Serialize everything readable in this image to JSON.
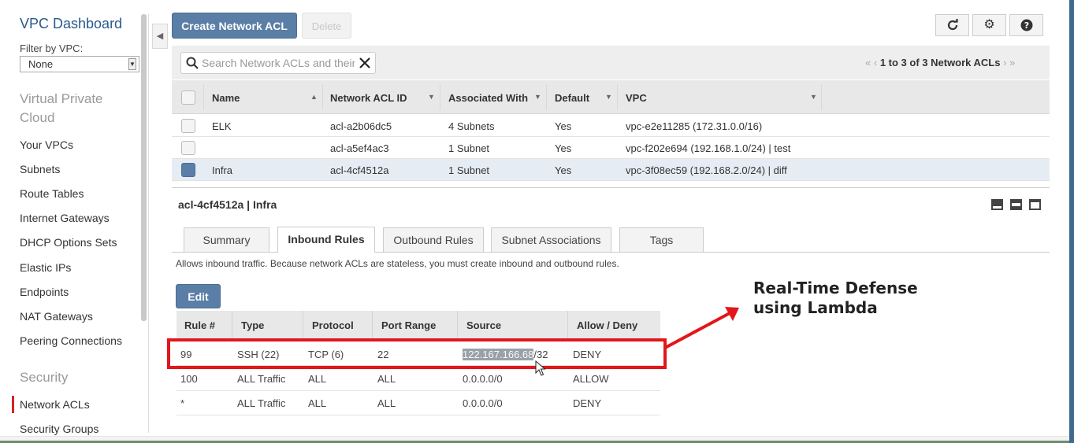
{
  "sidebar": {
    "title": "VPC Dashboard",
    "filter_label": "Filter by VPC:",
    "filter_value": "None",
    "section_vpc": "Virtual Private Cloud",
    "items": [
      "Your VPCs",
      "Subnets",
      "Route Tables",
      "Internet Gateways",
      "DHCP Options Sets",
      "Elastic IPs",
      "Endpoints",
      "NAT Gateways",
      "Peering Connections"
    ],
    "section_security": "Security",
    "security_items": [
      "Network ACLs",
      "Security Groups"
    ],
    "active_item": "Network ACLs",
    "active_color": "#d62424"
  },
  "toolbar": {
    "create_label": "Create Network ACL",
    "delete_label": "Delete",
    "refresh_icon": "refresh-icon",
    "settings_icon": "gear-icon",
    "help_icon": "help-icon"
  },
  "search": {
    "placeholder": "Search Network ACLs and their proper",
    "value": ""
  },
  "pager": {
    "text": "1 to 3 of 3 Network ACLs"
  },
  "acl_table": {
    "columns": [
      "Name",
      "Network ACL ID",
      "Associated With",
      "Default",
      "VPC"
    ],
    "rows": [
      {
        "name": "ELK",
        "id": "acl-a2b06dc5",
        "associated": "4 Subnets",
        "default": "Yes",
        "vpc": "vpc-e2e11285 (172.31.0.0/16)",
        "selected": false
      },
      {
        "name": "",
        "id": "acl-a5ef4ac3",
        "associated": "1 Subnet",
        "default": "Yes",
        "vpc": "vpc-f202e694 (192.168.1.0/24) | test",
        "selected": false
      },
      {
        "name": "Infra",
        "id": "acl-4cf4512a",
        "associated": "1 Subnet",
        "default": "Yes",
        "vpc": "vpc-3f08ec59 (192.168.2.0/24) | diff",
        "selected": true
      }
    ]
  },
  "detail": {
    "title": "acl-4cf4512a | Infra",
    "tabs": [
      "Summary",
      "Inbound Rules",
      "Outbound Rules",
      "Subnet Associations",
      "Tags"
    ],
    "active_tab": "Inbound Rules",
    "info": "Allows inbound traffic. Because network ACLs are stateless, you must create inbound and outbound rules.",
    "edit_label": "Edit"
  },
  "rules_table": {
    "columns": [
      "Rule #",
      "Type",
      "Protocol",
      "Port Range",
      "Source",
      "Allow / Deny"
    ],
    "rows": [
      {
        "rule": "99",
        "type": "SSH (22)",
        "protocol": "TCP (6)",
        "port": "22",
        "source_ip": "122.167.166.68",
        "source_mask": "/32",
        "action": "DENY"
      },
      {
        "rule": "100",
        "type": "ALL Traffic",
        "protocol": "ALL",
        "port": "ALL",
        "source_ip": "0.0.0.0/0",
        "source_mask": "",
        "action": "ALLOW"
      },
      {
        "rule": "*",
        "type": "ALL Traffic",
        "protocol": "ALL",
        "port": "ALL",
        "source_ip": "0.0.0.0/0",
        "source_mask": "",
        "action": "DENY"
      }
    ]
  },
  "annotation": {
    "line1": "Real-Time Defense",
    "line2": "using Lambda",
    "color": "#e3161b"
  }
}
